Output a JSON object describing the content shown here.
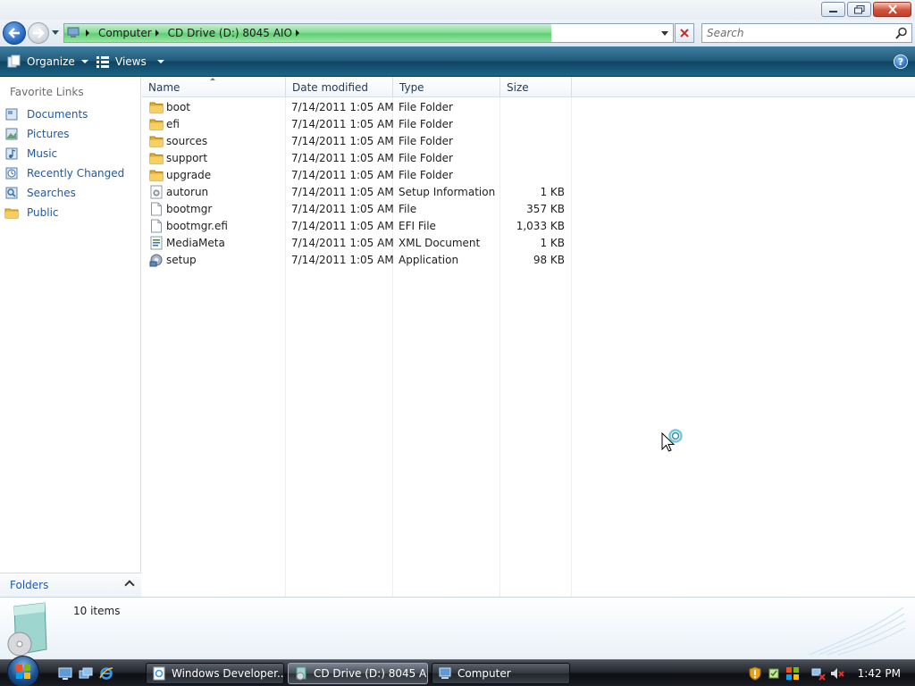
{
  "address": {
    "crumbs": [
      "Computer",
      "CD Drive (D:) 8045 AIO"
    ]
  },
  "search": {
    "placeholder": "Search"
  },
  "toolbar": {
    "organize_label": "Organize",
    "views_label": "Views"
  },
  "sidebar": {
    "header": "Favorite Links",
    "items": [
      {
        "label": "Documents",
        "icon": "documents-icon"
      },
      {
        "label": "Pictures",
        "icon": "pictures-icon"
      },
      {
        "label": "Music",
        "icon": "music-icon"
      },
      {
        "label": "Recently Changed",
        "icon": "recently-changed-icon"
      },
      {
        "label": "Searches",
        "icon": "searches-icon"
      },
      {
        "label": "Public",
        "icon": "public-folder-icon"
      }
    ],
    "folders_label": "Folders"
  },
  "columns": {
    "name": "Name",
    "date": "Date modified",
    "type": "Type",
    "size": "Size"
  },
  "files": [
    {
      "name": "boot",
      "date": "7/14/2011 1:05 AM",
      "type": "File Folder",
      "size": "",
      "icon": "folder-icon"
    },
    {
      "name": "efi",
      "date": "7/14/2011 1:05 AM",
      "type": "File Folder",
      "size": "",
      "icon": "folder-icon"
    },
    {
      "name": "sources",
      "date": "7/14/2011 1:05 AM",
      "type": "File Folder",
      "size": "",
      "icon": "folder-icon"
    },
    {
      "name": "support",
      "date": "7/14/2011 1:05 AM",
      "type": "File Folder",
      "size": "",
      "icon": "folder-icon"
    },
    {
      "name": "upgrade",
      "date": "7/14/2011 1:05 AM",
      "type": "File Folder",
      "size": "",
      "icon": "folder-icon"
    },
    {
      "name": "autorun",
      "date": "7/14/2011 1:05 AM",
      "type": "Setup Information",
      "size": "1 KB",
      "icon": "setup-info-icon"
    },
    {
      "name": "bootmgr",
      "date": "7/14/2011 1:05 AM",
      "type": "File",
      "size": "357 KB",
      "icon": "file-icon"
    },
    {
      "name": "bootmgr.efi",
      "date": "7/14/2011 1:05 AM",
      "type": "EFI File",
      "size": "1,033 KB",
      "icon": "file-icon"
    },
    {
      "name": "MediaMeta",
      "date": "7/14/2011 1:05 AM",
      "type": "XML Document",
      "size": "1 KB",
      "icon": "xml-document-icon"
    },
    {
      "name": "setup",
      "date": "7/14/2011 1:05 AM",
      "type": "Application",
      "size": "98 KB",
      "icon": "application-icon"
    }
  ],
  "details": {
    "item_count": "10 items"
  },
  "taskbar": {
    "tasks": [
      {
        "label": "Windows Developer...",
        "icon": "ie-page-icon"
      },
      {
        "label": "CD Drive (D:) 8045 A...",
        "icon": "cd-drive-icon"
      },
      {
        "label": "Computer",
        "icon": "computer-icon"
      }
    ],
    "clock": "1:42 PM"
  },
  "colors": {
    "toolbar": "#225a79",
    "link": "#1e5aa8",
    "address_progress": "#5fcf72"
  }
}
